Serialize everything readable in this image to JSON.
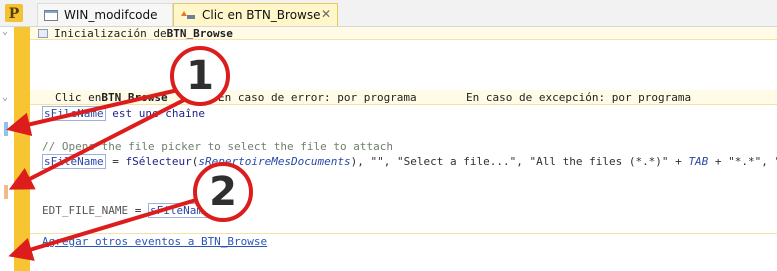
{
  "tabs": [
    {
      "label": "WIN_modifcode",
      "active": false,
      "icon": "window-icon"
    },
    {
      "label": "Clic en BTN_Browse",
      "active": true,
      "icon": "event-icon"
    }
  ],
  "close_glyph": "✕",
  "app_logo_letter": "P",
  "fold_glyph": "⌄",
  "sections": {
    "init": {
      "prefix": "Inicialización de ",
      "name": "BTN_Browse"
    },
    "click": {
      "prefix": "Clic en ",
      "name": "BTN_Browse",
      "error_handling": "En caso de error: por programa",
      "exception_handling": "En caso de excepción: por programa"
    }
  },
  "code": {
    "line1": {
      "var": "sFileName",
      "rest": " est une ",
      "type": "chaîne"
    },
    "line2": {
      "comment": "// Opens the file picker to select the file to attach"
    },
    "line3": {
      "var": "sFileName",
      "op": " = ",
      "func": "fSélecteur",
      "open": "(",
      "arg1": "sRepertoireMesDocuments",
      "mid": "), \"\", \"Select a file...\", \"All the files (*.*)\" + ",
      "tab": "TAB",
      "end": " + \"*.*\", \"*.*"
    },
    "line4": {
      "lhs": "EDT_FILE_NAME",
      "op": " = ",
      "var": "sFileName"
    }
  },
  "add_events_link": "Agregar otros eventos a BTN_Browse",
  "callouts": [
    {
      "number": "1"
    },
    {
      "number": "2"
    }
  ],
  "colors": {
    "accent_yellow": "#f7c531",
    "annotation_red": "#dd1c1c",
    "marker_blue": "#8fc3e8",
    "marker_orange": "#f5b88a"
  }
}
